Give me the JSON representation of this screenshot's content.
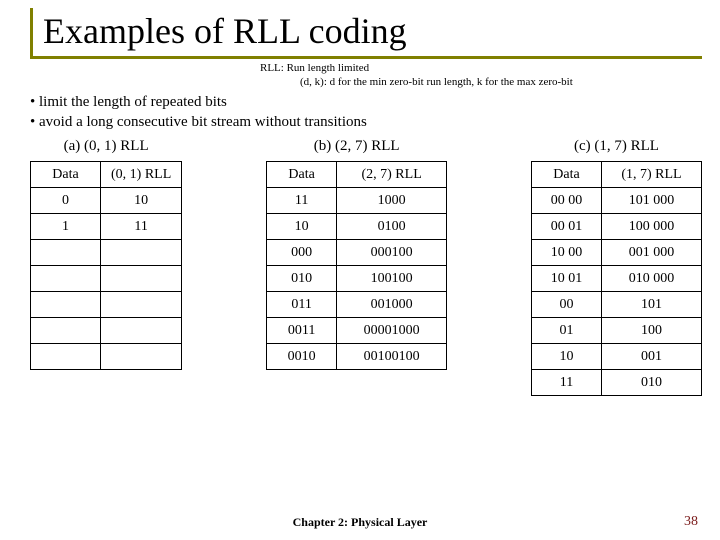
{
  "title": "Examples of RLL coding",
  "notes": {
    "line1": "RLL: Run length limited",
    "line2": "(d, k): d for the min zero-bit run length, k for the max zero-bit"
  },
  "bullets": {
    "b1": "• limit the length of repeated bits",
    "b2": "• avoid a long consecutive bit stream without transitions"
  },
  "tableA": {
    "caption": "(a) (0, 1) RLL",
    "h1": "Data",
    "h2": "(0, 1) RLL",
    "rows": [
      {
        "d": "0",
        "c": "10"
      },
      {
        "d": "1",
        "c": "11"
      }
    ],
    "emptyRows": 5
  },
  "tableB": {
    "caption": "(b) (2, 7) RLL",
    "h1": "Data",
    "h2": "(2, 7) RLL",
    "rows": [
      {
        "d": "11",
        "c": "1000"
      },
      {
        "d": "10",
        "c": "0100"
      },
      {
        "d": "000",
        "c": "000100"
      },
      {
        "d": "010",
        "c": "100100"
      },
      {
        "d": "011",
        "c": "001000"
      },
      {
        "d": "0011",
        "c": "00001000"
      },
      {
        "d": "0010",
        "c": "00100100"
      }
    ],
    "emptyRows": 0
  },
  "tableC": {
    "caption": "(c) (1, 7) RLL",
    "h1": "Data",
    "h2": "(1, 7) RLL",
    "rows": [
      {
        "d": "00 00",
        "c": "101 000"
      },
      {
        "d": "00 01",
        "c": "100 000"
      },
      {
        "d": "10 00",
        "c": "001 000"
      },
      {
        "d": "10 01",
        "c": "010 000"
      },
      {
        "d": "00",
        "c": "101"
      },
      {
        "d": "01",
        "c": "100"
      },
      {
        "d": "10",
        "c": "001"
      },
      {
        "d": "11",
        "c": "010"
      }
    ],
    "emptyRows": 0
  },
  "footer": "Chapter 2: Physical Layer",
  "pageNumber": "38"
}
